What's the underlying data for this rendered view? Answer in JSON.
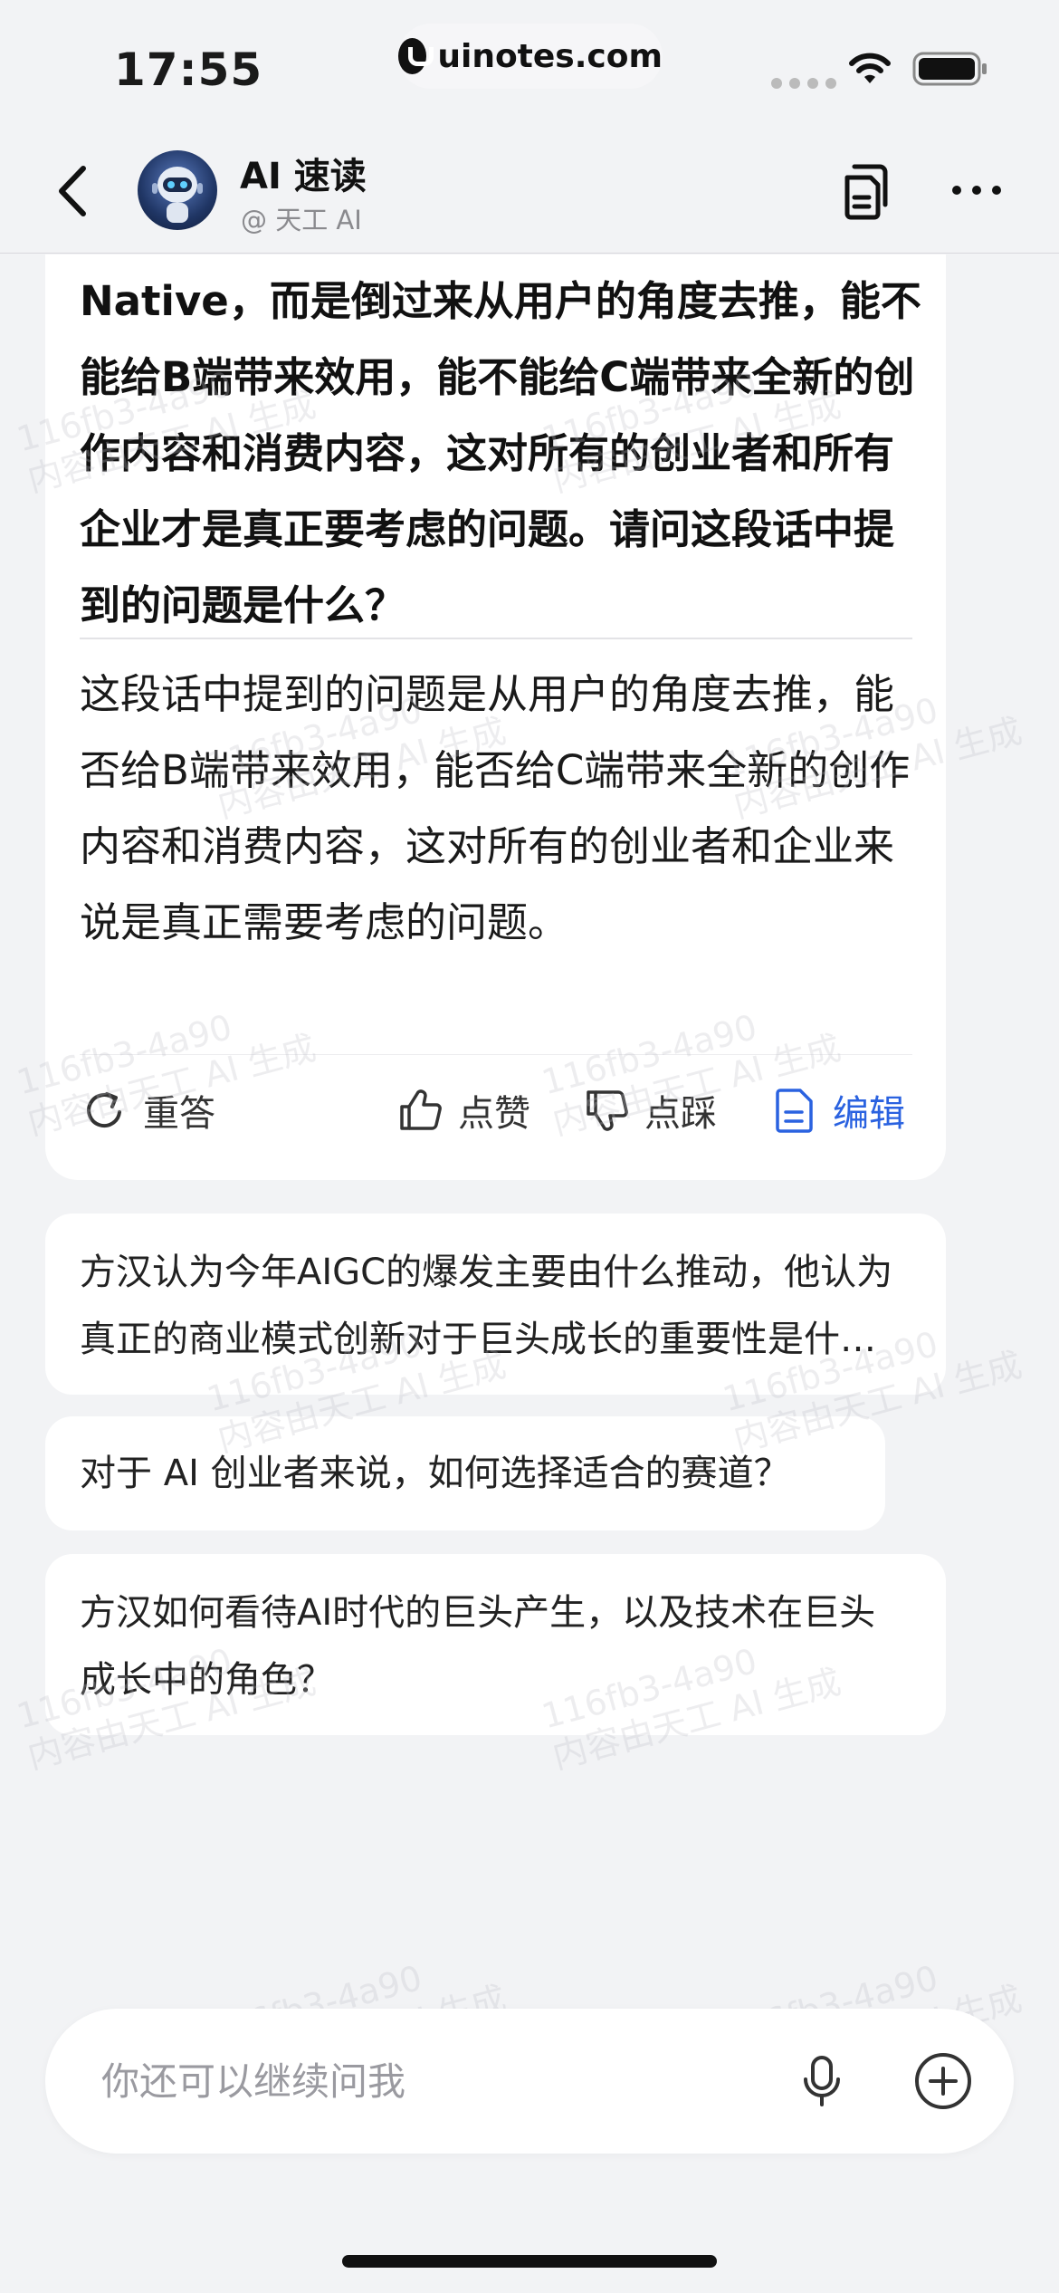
{
  "status_bar": {
    "time": "17:55",
    "url": "uinotes.com"
  },
  "header": {
    "title": "AI 速读",
    "subtitle": "@ 天工 AI"
  },
  "conversation": {
    "question": "Native，而是倒过来从用户的角度去推，能不能给B端带来效用，能不能给C端带来全新的创作内容和消费内容，这对所有的创业者和所有企业才是真正要考虑的问题。请问这段话中提到的问题是什么？",
    "answer": "这段话中提到的问题是从用户的角度去推，能否给B端带来效用，能否给C端带来全新的创作内容和消费内容，这对所有的创业者和企业来说是真正需要考虑的问题。"
  },
  "actions": {
    "retry": "重答",
    "like": "点赞",
    "dislike": "点踩",
    "edit": "编辑"
  },
  "suggestions": [
    "方汉认为今年AIGC的爆发主要由什么推动，他认为真正的商业模式创新对于巨头成长的重要性是什么？",
    "对于 AI 创业者来说，如何选择适合的赛道？",
    "方汉如何看待AI时代的巨头产生，以及技术在巨头成长中的角色？"
  ],
  "watermark": {
    "line1": "116fb3-4a90",
    "line2": "内容由天工 AI 生成"
  },
  "input": {
    "placeholder": "你还可以继续问我"
  },
  "colors": {
    "accent": "#2a62e0",
    "background": "#f2f3f5",
    "card": "#ffffff"
  }
}
